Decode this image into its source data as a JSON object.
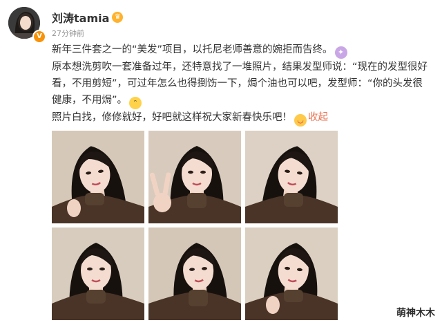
{
  "post": {
    "author": "刘涛tamia",
    "member_icon": "crown-badge-icon",
    "verified_icon": "verified-v-icon",
    "timestamp": "27分钟前",
    "line1": "新年三件套之一的“美发”项目，以托尼老师善意的婉拒而告终。",
    "line2": "原本想洗剪吹一套准备过年，还特意找了一堆照片，结果发型师说：“现在的发型很好看，不用剪短”，可过年怎么也得捯饬一下，焗个油也可以吧，发型师：“你的头发很健康，不用焗”。",
    "line3": "照片白找，修修就好，好吧就这样祝大家新春快乐吧！",
    "collapse_label": "收起",
    "emojis": [
      "pray-emoji-icon",
      "laugh-emoji-icon",
      "tongue-emoji-icon"
    ]
  },
  "photos": [
    {
      "name": "photo-1",
      "wall": "#d6c8b8"
    },
    {
      "name": "photo-2",
      "wall": "#d8cbbd"
    },
    {
      "name": "photo-3",
      "wall": "#dcd1c4"
    },
    {
      "name": "photo-4",
      "wall": "#d8ccbe"
    },
    {
      "name": "photo-5",
      "wall": "#d5c7b7"
    },
    {
      "name": "photo-6",
      "wall": "#dbcfc1"
    }
  ],
  "watermark": "萌神木木",
  "colors": {
    "link": "#eb7350",
    "verified": "#f79209",
    "text": "#333333",
    "muted": "#939393"
  }
}
